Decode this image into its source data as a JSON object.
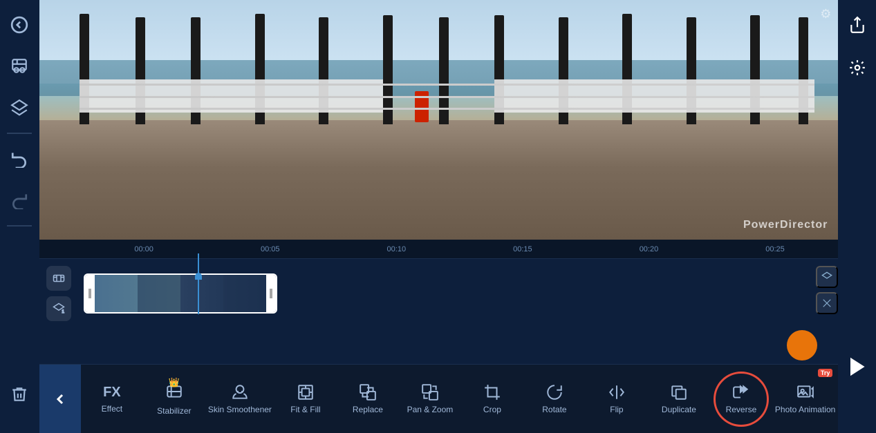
{
  "app": {
    "title": "PowerDirector",
    "watermark": "PowerDirector"
  },
  "sidebar": {
    "back_icon": "◀",
    "media_icon": "🎬",
    "layers_icon": "◇",
    "undo_icon": "↩",
    "redo_icon": "↪",
    "delete_icon": "🗑"
  },
  "right_panel": {
    "share_icon": "⬆",
    "settings_icon": "⚙",
    "play_icon": "▶"
  },
  "timeline": {
    "ruler_marks": [
      "00:00",
      "00:05",
      "00:10",
      "00:15",
      "00:20",
      "00:25"
    ]
  },
  "toolbar": {
    "back_label": "‹",
    "items": [
      {
        "id": "fx",
        "label": "Effect",
        "icon": "FX",
        "has_crown": false,
        "try_badge": false
      },
      {
        "id": "stabilizer",
        "label": "Stabilizer",
        "icon": "🖼",
        "has_crown": true,
        "try_badge": false
      },
      {
        "id": "skin-smoothener",
        "label": "Skin Smoothener",
        "icon": "😊",
        "has_crown": false,
        "try_badge": false
      },
      {
        "id": "fit-fill",
        "label": "Fit & Fill",
        "icon": "▦",
        "has_crown": false,
        "try_badge": false
      },
      {
        "id": "replace",
        "label": "Replace",
        "icon": "⧉",
        "has_crown": false,
        "try_badge": false
      },
      {
        "id": "pan-zoom",
        "label": "Pan & Zoom",
        "icon": "⧉",
        "has_crown": false,
        "try_badge": false
      },
      {
        "id": "crop",
        "label": "Crop",
        "icon": "⊡",
        "has_crown": false,
        "try_badge": false
      },
      {
        "id": "rotate",
        "label": "Rotate",
        "icon": "↻",
        "has_crown": false,
        "try_badge": false
      },
      {
        "id": "flip",
        "label": "Flip",
        "icon": "⇌",
        "has_crown": false,
        "try_badge": false
      },
      {
        "id": "duplicate",
        "label": "Duplicate",
        "icon": "❑",
        "has_crown": false,
        "try_badge": false
      },
      {
        "id": "reverse",
        "label": "Reverse",
        "icon": "⏪",
        "has_crown": false,
        "try_badge": false,
        "is_highlighted": true
      },
      {
        "id": "photo-animation",
        "label": "Photo Animation",
        "icon": "🏃",
        "has_crown": false,
        "try_badge": true
      }
    ]
  },
  "colors": {
    "bg_dark": "#0a1628",
    "sidebar_bg": "#0d1f3c",
    "accent_blue": "#1a3a6a",
    "text_muted": "#a0b8d8",
    "playhead_blue": "#3a8fd4",
    "orange": "#e8740a",
    "red_circle": "#e74c3c",
    "try_red": "#e74c3c"
  }
}
